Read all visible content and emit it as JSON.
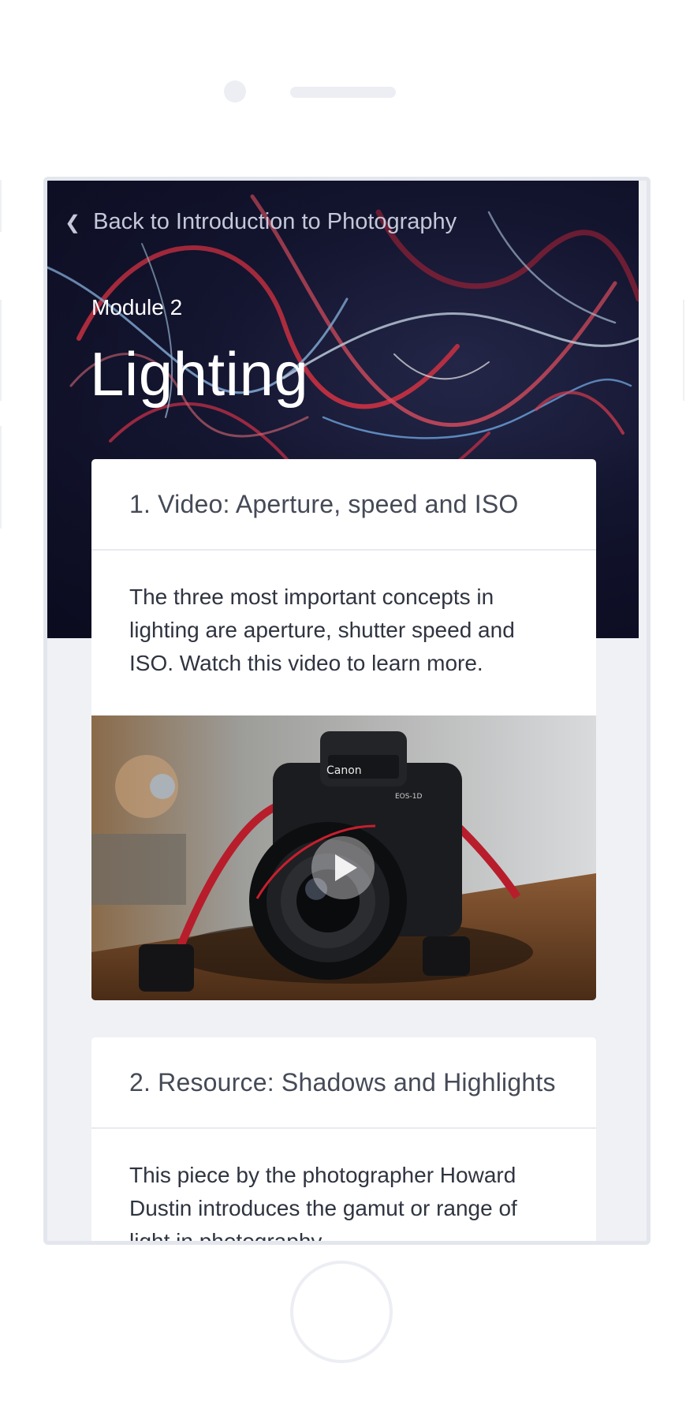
{
  "nav": {
    "back_label": "Back to Introduction to Photography"
  },
  "module": {
    "label": "Module 2",
    "title": "Lighting"
  },
  "items": [
    {
      "title": "1. Video: Aperture, speed and ISO",
      "description": "The three most important concepts in lighting are aperture, shutter speed and ISO. Watch this video to learn more.",
      "media": "video-thumbnail"
    },
    {
      "title": "2. Resource: Shadows and Highlights",
      "description": "This piece by the photographer Howard Dustin introduces the gamut or range of light in photography"
    }
  ],
  "colors": {
    "hero_dark": "#161834",
    "screen_background": "#eff1f5",
    "card_background": "#ffffff",
    "text": "#2f3440",
    "muted_text": "#c4c8d8"
  },
  "icons": [
    "chevron-left-icon",
    "play-icon"
  ]
}
